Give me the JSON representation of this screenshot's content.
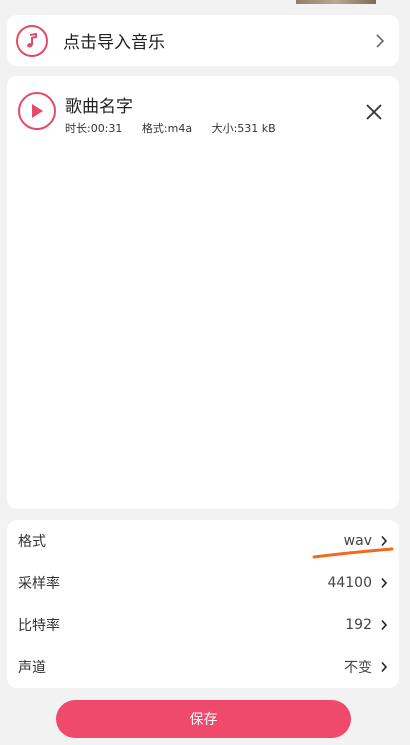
{
  "import": {
    "label": "点击导入音乐"
  },
  "song": {
    "title": "歌曲名字",
    "duration": "时长:00:31",
    "format": "格式:m4a",
    "size": "大小:531 kB"
  },
  "settings": [
    {
      "label": "格式",
      "value": "wav"
    },
    {
      "label": "采样率",
      "value": "44100"
    },
    {
      "label": "比特率",
      "value": "192"
    },
    {
      "label": "声道",
      "value": "不变"
    }
  ],
  "save_label": "保存",
  "colors": {
    "accent": "#ef4a6b",
    "annotation": "#f26a1b",
    "background": "#f2f2f2"
  },
  "icons": [
    "music-note-icon",
    "chevron-right-icon",
    "play-icon",
    "close-icon"
  ]
}
